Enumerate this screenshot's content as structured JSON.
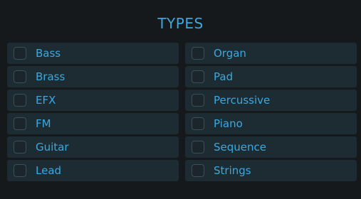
{
  "title": "TYPES",
  "types": {
    "left": [
      {
        "label": "Bass",
        "checked": false
      },
      {
        "label": "Brass",
        "checked": false
      },
      {
        "label": "EFX",
        "checked": false
      },
      {
        "label": "FM",
        "checked": false
      },
      {
        "label": "Guitar",
        "checked": false
      },
      {
        "label": "Lead",
        "checked": false
      }
    ],
    "right": [
      {
        "label": "Organ",
        "checked": false
      },
      {
        "label": "Pad",
        "checked": false
      },
      {
        "label": "Percussive",
        "checked": false
      },
      {
        "label": "Piano",
        "checked": false
      },
      {
        "label": "Sequence",
        "checked": false
      },
      {
        "label": "Strings",
        "checked": false
      }
    ]
  },
  "colors": {
    "background": "#16191b",
    "item_background": "#1d2c33",
    "accent_text": "#3aa8e0",
    "checkbox_border": "#3e4e55"
  }
}
